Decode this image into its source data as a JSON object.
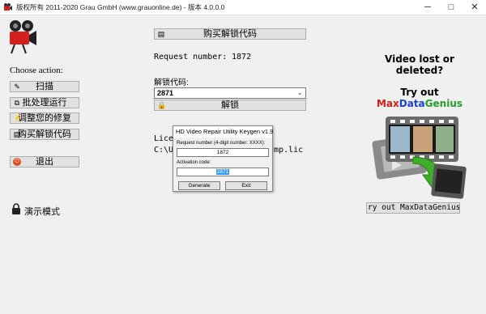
{
  "window": {
    "title": "版权所有 2011-2020 Grau GmbH (www.grauonline.de) - 版本 4.0.0.0",
    "min_glyph": "─",
    "max_glyph": "□",
    "close_glyph": "✕"
  },
  "sidebar": {
    "heading": "Choose action:",
    "scan_label": "扫描",
    "batch_label": "批处理运行",
    "adjust_label": "调整您的修复",
    "buy_label": "购买解锁代码",
    "exit_label": "退出",
    "demo_label": "演示模式"
  },
  "main": {
    "buy_unlock_label": "购买解锁代码",
    "request_label": "Request number:",
    "request_value": "1872",
    "unlock_code_label": "解锁代码:",
    "unlock_code_value": "2871",
    "unlock_button_label": "解锁",
    "license_label_partial": "Lice",
    "license_path_start": "C:\\U",
    "license_path_end": "mp.lic"
  },
  "promo": {
    "line1": "Video lost or",
    "line2": "deleted?",
    "line3": "Try out",
    "brand_max": "Max",
    "brand_data": "Data",
    "brand_genius": "Genius",
    "try_button_label": "ry out MaxDataGenius.."
  },
  "keygen": {
    "title": "HD Video Repair Utility Keygen v1.9",
    "request_label": "Request number (4-digit number: XXXX):",
    "request_value": "1872",
    "activation_label": "Activation code:",
    "activation_value": "2871",
    "generate_label": "Generate",
    "exit_label": "Exit"
  },
  "colors": {
    "brand_max": "#d61a1a",
    "brand_data": "#1a3fd6",
    "brand_genius": "#1f9e2b",
    "selection": "#3399ff",
    "arrow_green": "#3fae2a"
  }
}
